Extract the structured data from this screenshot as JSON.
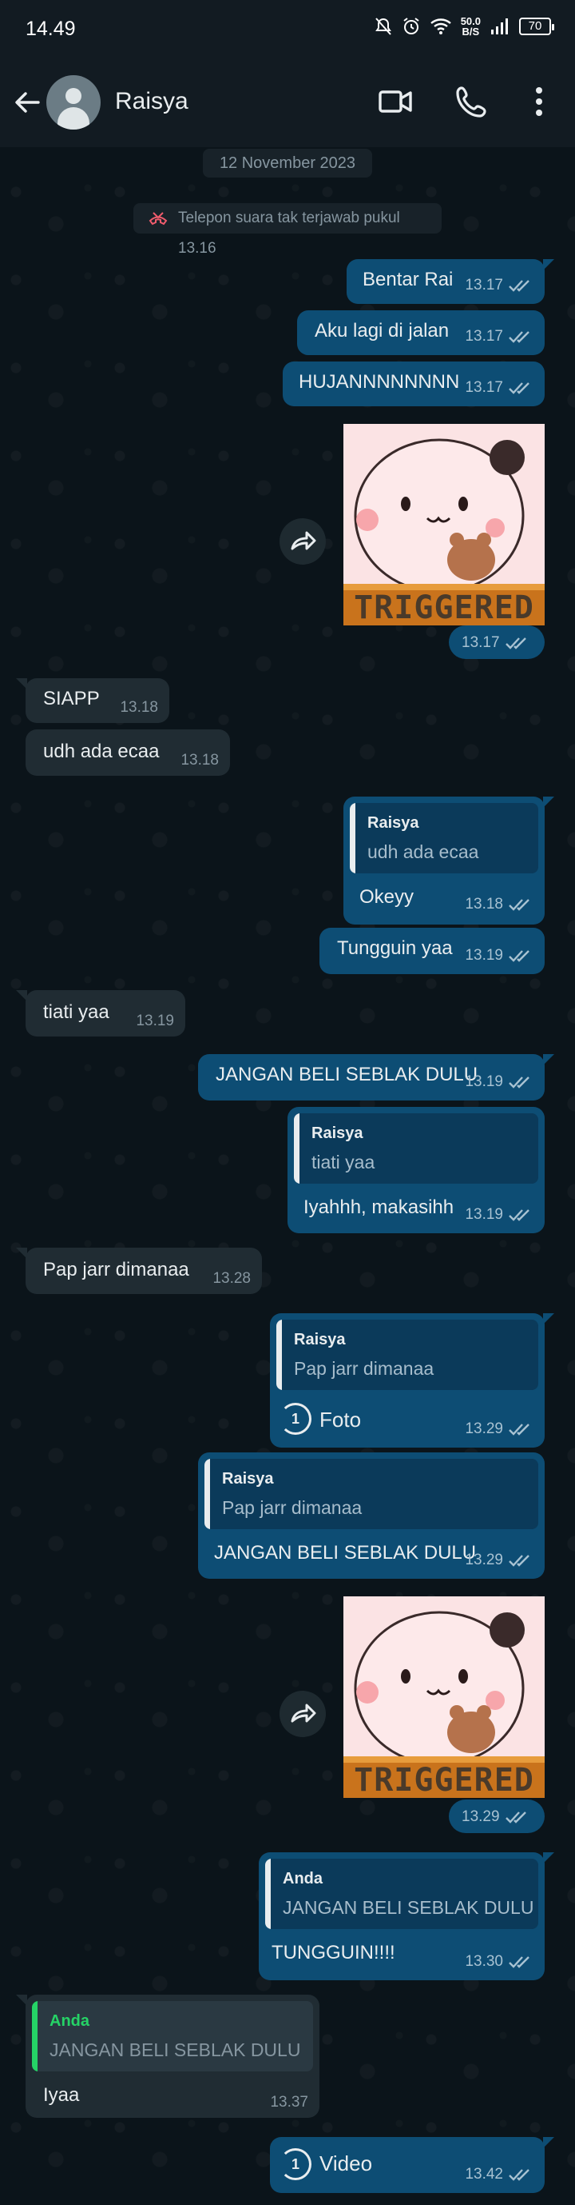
{
  "status_bar": {
    "time": "14.49",
    "net_speed_top": "50.0",
    "net_speed_bottom": "B/S",
    "battery": "70"
  },
  "header": {
    "contact_name": "Raisya",
    "icons": [
      "back-arrow-icon",
      "avatar",
      "video-call-icon",
      "voice-call-icon",
      "more-vert-icon"
    ]
  },
  "date_chip": "12 November 2023",
  "missed_call": "Telepon suara tak terjawab pukul 13.16",
  "messages": [
    {
      "dir": "out",
      "text": "Bentar Rai",
      "time": "13.17"
    },
    {
      "dir": "out",
      "text": "Aku lagi di jalan",
      "time": "13.17"
    },
    {
      "dir": "out",
      "text": "HUJANNNNNNNN",
      "time": "13.17"
    },
    {
      "dir": "out",
      "type": "sticker",
      "sticker_text": "TRIGGERED",
      "time": "13.17"
    },
    {
      "dir": "in",
      "text": "SIAPP",
      "time": "13.18"
    },
    {
      "dir": "in",
      "text": "udh ada ecaa",
      "time": "13.18"
    },
    {
      "dir": "out",
      "quote_author": "Raisya",
      "quote_text": "udh ada ecaa",
      "text": "Okeyy",
      "time": "13.18"
    },
    {
      "dir": "out",
      "text": "Tungguin yaa",
      "time": "13.19"
    },
    {
      "dir": "in",
      "text": "tiati yaa",
      "time": "13.19"
    },
    {
      "dir": "out",
      "text": "JANGAN BELI SEBLAK DULU",
      "time": "13.19"
    },
    {
      "dir": "out",
      "quote_author": "Raisya",
      "quote_text": "tiati yaa",
      "text": "Iyahhh, makasihh",
      "time": "13.19"
    },
    {
      "dir": "in",
      "text": "Pap jarr dimanaa",
      "time": "13.28"
    },
    {
      "dir": "out",
      "quote_author": "Raisya",
      "quote_text": "Pap jarr dimanaa",
      "once_label": "1",
      "text": "Foto",
      "time": "13.29"
    },
    {
      "dir": "out",
      "quote_author": "Raisya",
      "quote_text": "Pap jarr dimanaa",
      "text": "JANGAN BELI SEBLAK DULU",
      "time": "13.29"
    },
    {
      "dir": "out",
      "type": "sticker",
      "sticker_text": "TRIGGERED",
      "time": "13.29"
    },
    {
      "dir": "out",
      "quote_author": "Anda",
      "quote_text": "JANGAN BELI SEBLAK DULU",
      "text": "TUNGGUIN!!!!",
      "time": "13.30"
    },
    {
      "dir": "in",
      "quote_author": "Anda",
      "quote_text": "JANGAN BELI SEBLAK DULU",
      "text": "Iyaa",
      "time": "13.37"
    },
    {
      "dir": "out",
      "once_label": "1",
      "text": "Video",
      "time": "13.42"
    }
  ],
  "colors": {
    "background": "#0b141a",
    "header": "#121b22",
    "outgoing_bubble": "#0d4d74",
    "incoming_bubble": "#202c33",
    "read_tick": "#a8c2d2",
    "quote_accent_green": "#25d366"
  }
}
